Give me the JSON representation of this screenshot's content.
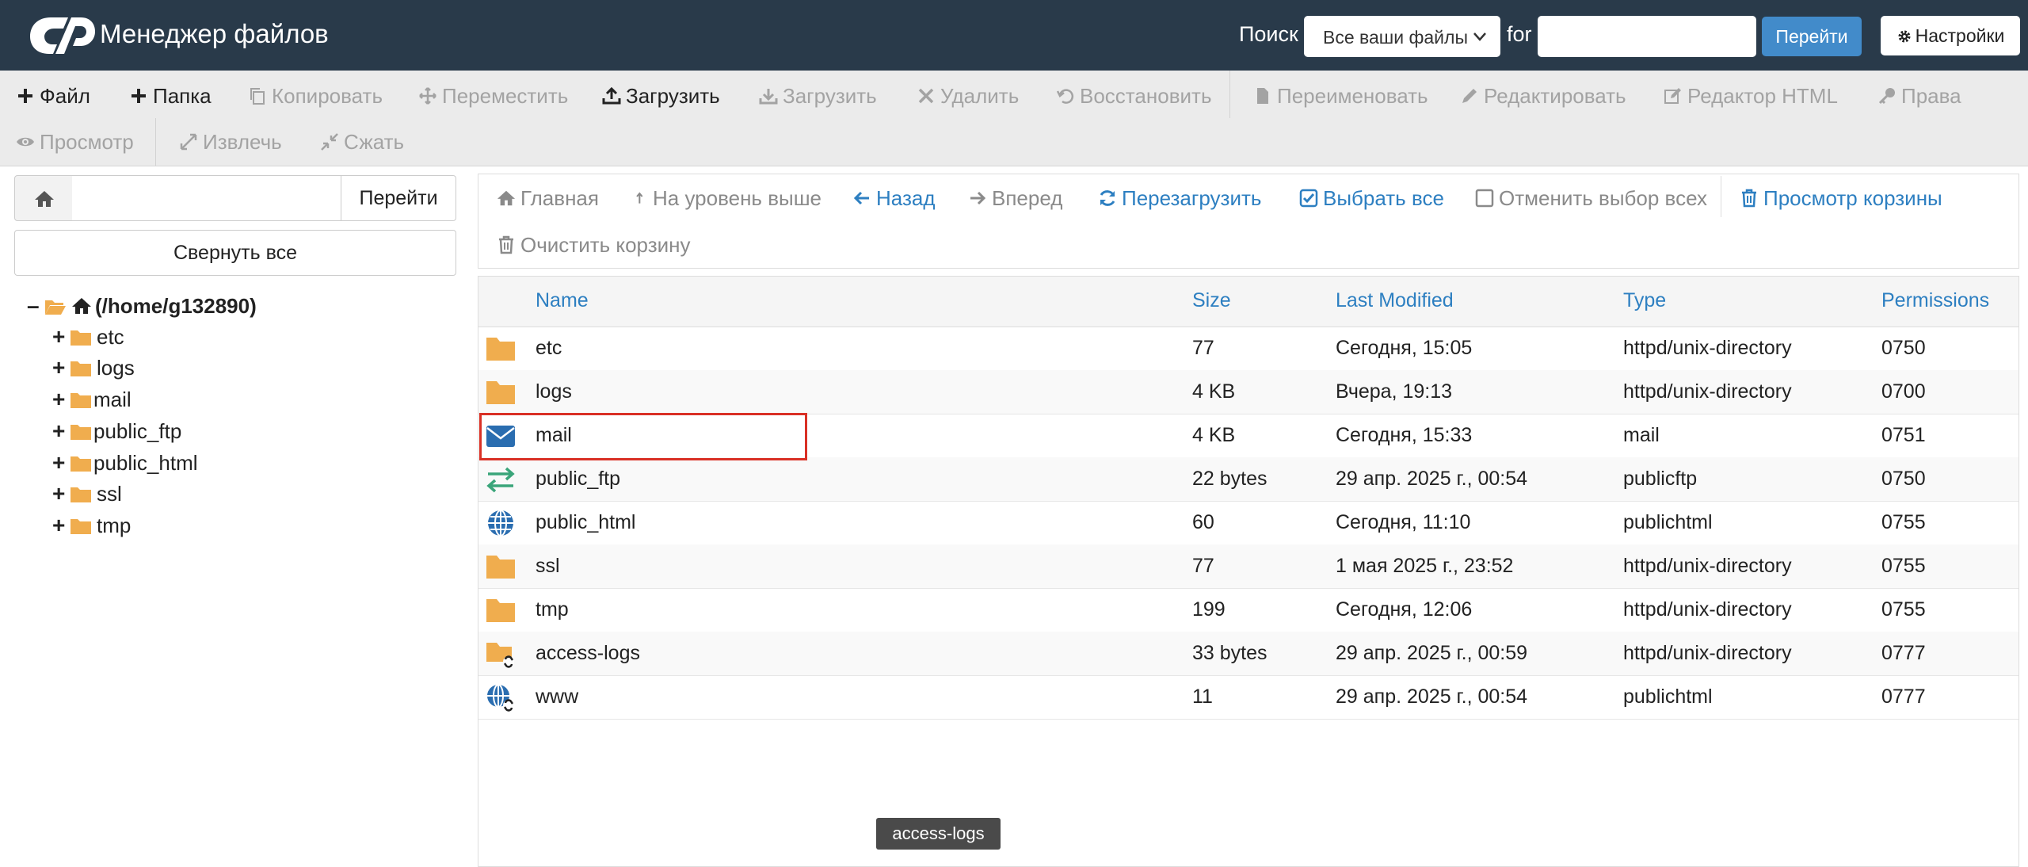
{
  "header": {
    "title": "Менеджер файлов",
    "search_label": "Поиск",
    "search_scope": "Все ваши файлы",
    "for_label": "for",
    "search_value": "",
    "go_label": "Перейти",
    "settings_label": "Настройки"
  },
  "toolbar": {
    "file": "Файл",
    "folder": "Папка",
    "copy": "Копировать",
    "move": "Переместить",
    "upload": "Загрузить",
    "download": "Загрузить",
    "delete": "Удалить",
    "restore": "Восстановить",
    "rename": "Переименовать",
    "edit": "Редактировать",
    "html_editor": "Редактор HTML",
    "permissions": "Права",
    "view": "Просмотр",
    "extract": "Извлечь",
    "compress": "Сжать"
  },
  "left": {
    "path_value": "",
    "go_label": "Перейти",
    "collapse_label": "Свернуть все",
    "tree": {
      "root": "(/home/g132890)",
      "children": [
        "etc",
        "logs",
        "mail",
        "public_ftp",
        "public_html",
        "ssl",
        "tmp"
      ]
    }
  },
  "nav": {
    "home": "Главная",
    "up": "На уровень выше",
    "back": "Назад",
    "forward": "Вперед",
    "reload": "Перезагрузить",
    "select_all": "Выбрать все",
    "unselect_all": "Отменить выбор всех",
    "view_trash": "Просмотр корзины",
    "empty_trash": "Очистить корзину"
  },
  "table": {
    "headers": {
      "name": "Name",
      "size": "Size",
      "modified": "Last Modified",
      "type": "Type",
      "permissions": "Permissions"
    },
    "rows": [
      {
        "icon": "folder-icon",
        "name": "etc",
        "size": "77",
        "modified": "Сегодня, 15:05",
        "type": "httpd/unix-directory",
        "perms": "0750"
      },
      {
        "icon": "folder-icon",
        "name": "logs",
        "size": "4 KB",
        "modified": "Вчера, 19:13",
        "type": "httpd/unix-directory",
        "perms": "0700"
      },
      {
        "icon": "envelope-icon",
        "name": "mail",
        "size": "4 KB",
        "modified": "Сегодня, 15:33",
        "type": "mail",
        "perms": "0751"
      },
      {
        "icon": "transfer-arrows-icon",
        "name": "public_ftp",
        "size": "22 bytes",
        "modified": "29 апр. 2025 г., 00:54",
        "type": "publicftp",
        "perms": "0750"
      },
      {
        "icon": "globe-icon",
        "name": "public_html",
        "size": "60",
        "modified": "Сегодня, 11:10",
        "type": "publichtml",
        "perms": "0755"
      },
      {
        "icon": "folder-icon",
        "name": "ssl",
        "size": "77",
        "modified": "1 мая 2025 г., 23:52",
        "type": "httpd/unix-directory",
        "perms": "0755"
      },
      {
        "icon": "folder-icon",
        "name": "tmp",
        "size": "199",
        "modified": "Сегодня, 12:06",
        "type": "httpd/unix-directory",
        "perms": "0755"
      },
      {
        "icon": "folder-link-icon",
        "name": "access-logs",
        "size": "33 bytes",
        "modified": "29 апр. 2025 г., 00:59",
        "type": "httpd/unix-directory",
        "perms": "0777"
      },
      {
        "icon": "globe-link-icon",
        "name": "www",
        "size": "11",
        "modified": "29 апр. 2025 г., 00:54",
        "type": "publichtml",
        "perms": "0777"
      }
    ]
  },
  "tooltip": "access-logs",
  "colors": {
    "header_bg": "#293a4a",
    "accent_blue": "#428bca",
    "link_blue": "#2d7fc1",
    "folder_orange": "#f0ad4e",
    "highlight_red": "#d93025"
  }
}
